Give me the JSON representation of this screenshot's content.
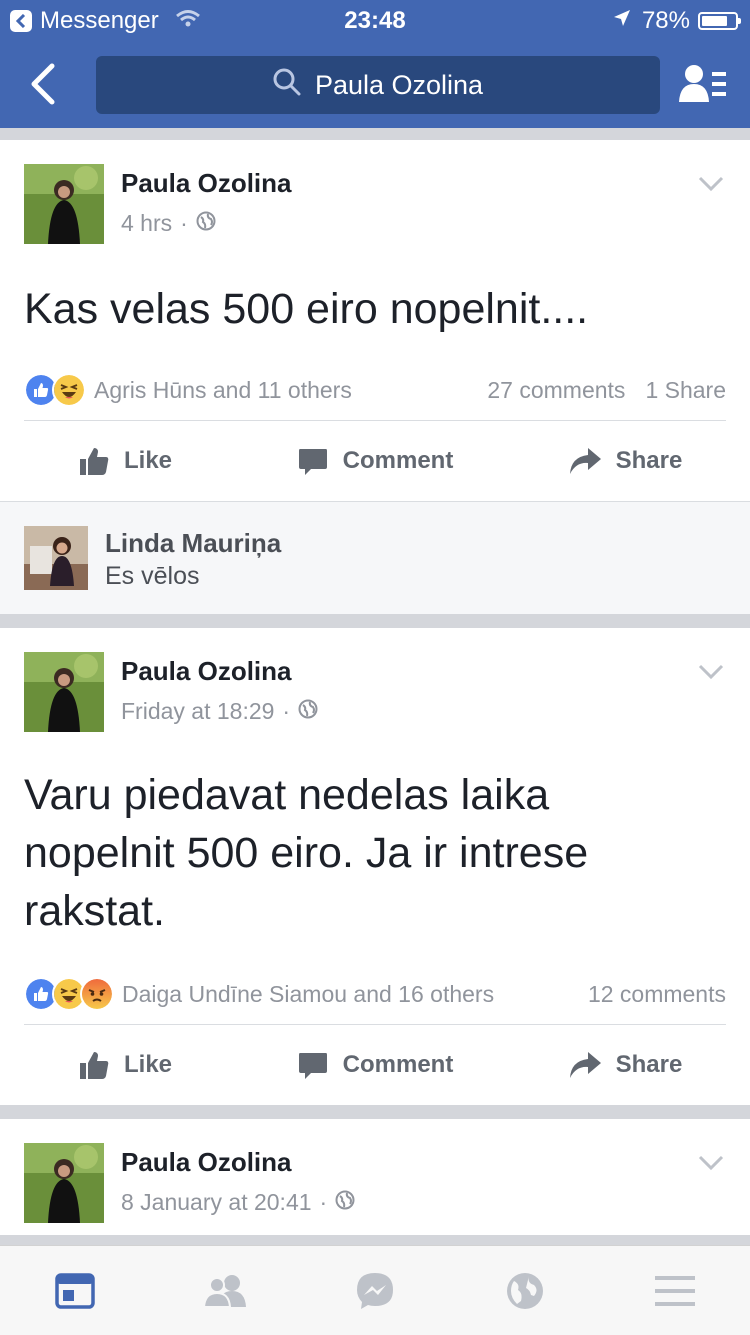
{
  "status_bar": {
    "back_app_label": "Messenger",
    "time": "23:48",
    "battery_text": "78%",
    "battery_level": 0.78
  },
  "header": {
    "search_text": "Paula Ozolina"
  },
  "posts": [
    {
      "author": "Paula Ozolina",
      "time": "4 hrs",
      "text": "Kas velas 500 eiro nopelnit....",
      "reactions_text": "Agris Hūns and 11 others",
      "comments_count": "27 comments",
      "shares_count": "1 Share",
      "comment_preview": {
        "author": "Linda Mauriņa",
        "text": "Es vēlos"
      }
    },
    {
      "author": "Paula Ozolina",
      "time": "Friday at 18:29",
      "text": "Varu piedavat nedelas laika nopelnit 500 eiro. Ja ir intrese rakstat.",
      "reactions_text": "Daiga Undīne Siamou and 16 others",
      "comments_count": "12 comments"
    },
    {
      "author": "Paula Ozolina",
      "time": "8 January at 20:41"
    }
  ],
  "actions": {
    "like": "Like",
    "comment": "Comment",
    "share": "Share"
  },
  "colors": {
    "brand_blue": "#4267b2",
    "search_bg": "#29487d",
    "active_tab": "#4267b2"
  }
}
